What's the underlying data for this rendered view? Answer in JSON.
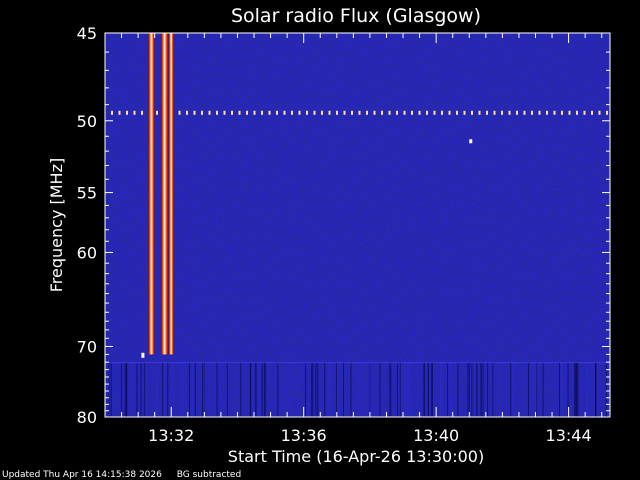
{
  "chart_data": {
    "type": "heatmap",
    "title": "Solar radio Flux (Glasgow)",
    "xlabel": "Start Time (16-Apr-26 13:30:00)",
    "ylabel": "Frequency [MHz]",
    "x_range_minutes": [
      13.0,
      13.75
    ],
    "x_ticks": [
      {
        "minute": 32,
        "label": "13:32"
      },
      {
        "minute": 36,
        "label": "13:36"
      },
      {
        "minute": 40,
        "label": "13:40"
      },
      {
        "minute": 44,
        "label": "13:44"
      }
    ],
    "y_range_mhz": [
      45,
      80
    ],
    "y_scale": "reciprocal",
    "y_ticks": [
      {
        "mhz": 45,
        "label": "45"
      },
      {
        "mhz": 50,
        "label": "50"
      },
      {
        "mhz": 55,
        "label": "55"
      },
      {
        "mhz": 60,
        "label": "60"
      },
      {
        "mhz": 70,
        "label": "70"
      },
      {
        "mhz": 80,
        "label": "80"
      }
    ],
    "bursts": [
      {
        "name": "burst-1",
        "time_minute": 31.4,
        "freq_start_mhz": 45,
        "freq_end_mhz": 71
      },
      {
        "name": "burst-2",
        "time_minute": 31.8,
        "freq_start_mhz": 45,
        "freq_end_mhz": 71
      },
      {
        "name": "burst-3",
        "time_minute": 32.0,
        "freq_start_mhz": 45,
        "freq_end_mhz": 71
      }
    ],
    "interference_line_mhz": 49.5,
    "colors": {
      "background": "#0a0a8c",
      "burst": "#ffffff",
      "burst_edge": "#ff5a00",
      "frame": "#ffffff"
    }
  },
  "footer": {
    "updated": "Updated Thu Apr 16 14:15:38 2026",
    "note": "BG subtracted"
  }
}
